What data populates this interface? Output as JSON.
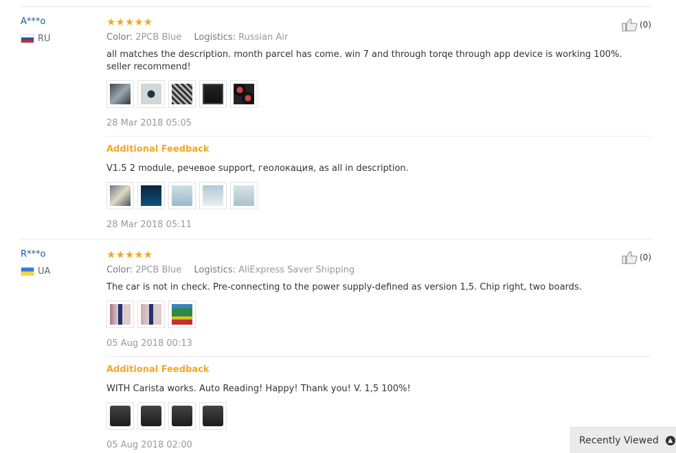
{
  "reviews": [
    {
      "user": "A***o",
      "country": "RU",
      "stars": "★★★★★",
      "color_label": "Color:",
      "color_value": "2PCB Blue",
      "logistics_label": "Logistics:",
      "logistics_value": "Russian Air",
      "text": "all matches the description. month parcel has come. win 7 and through torqe through app device is working 100%. seller recommend!",
      "date": "28 Mar 2018 05:05",
      "useful_count": "(0)",
      "additional_label": "Additional Feedback",
      "additional_text": "V1.5 2 module, речевое support, геолокация, as all in description.",
      "additional_date": "28 Mar 2018 05:11"
    },
    {
      "user": "R***o",
      "country": "UA",
      "stars": "★★★★★",
      "color_label": "Color:",
      "color_value": "2PCB Blue",
      "logistics_label": "Logistics:",
      "logistics_value": "AliExpress Saver Shipping",
      "text": "The car is not in check. Pre-connecting to the power supply-defined as version 1,5. Chip right, two boards.",
      "date": "05 Aug 2018 00:13",
      "useful_count": "(0)",
      "additional_label": "Additional Feedback",
      "additional_text": "WITH Carista works. Auto Reading! Happy! Thank you! V. 1,5 100%!",
      "additional_date": "05 Aug 2018 02:00"
    }
  ],
  "recently_viewed": "Recently Viewed",
  "colors": {
    "star": "#f5a623",
    "username": "#0e5ba8",
    "additional": "#f5a623"
  }
}
